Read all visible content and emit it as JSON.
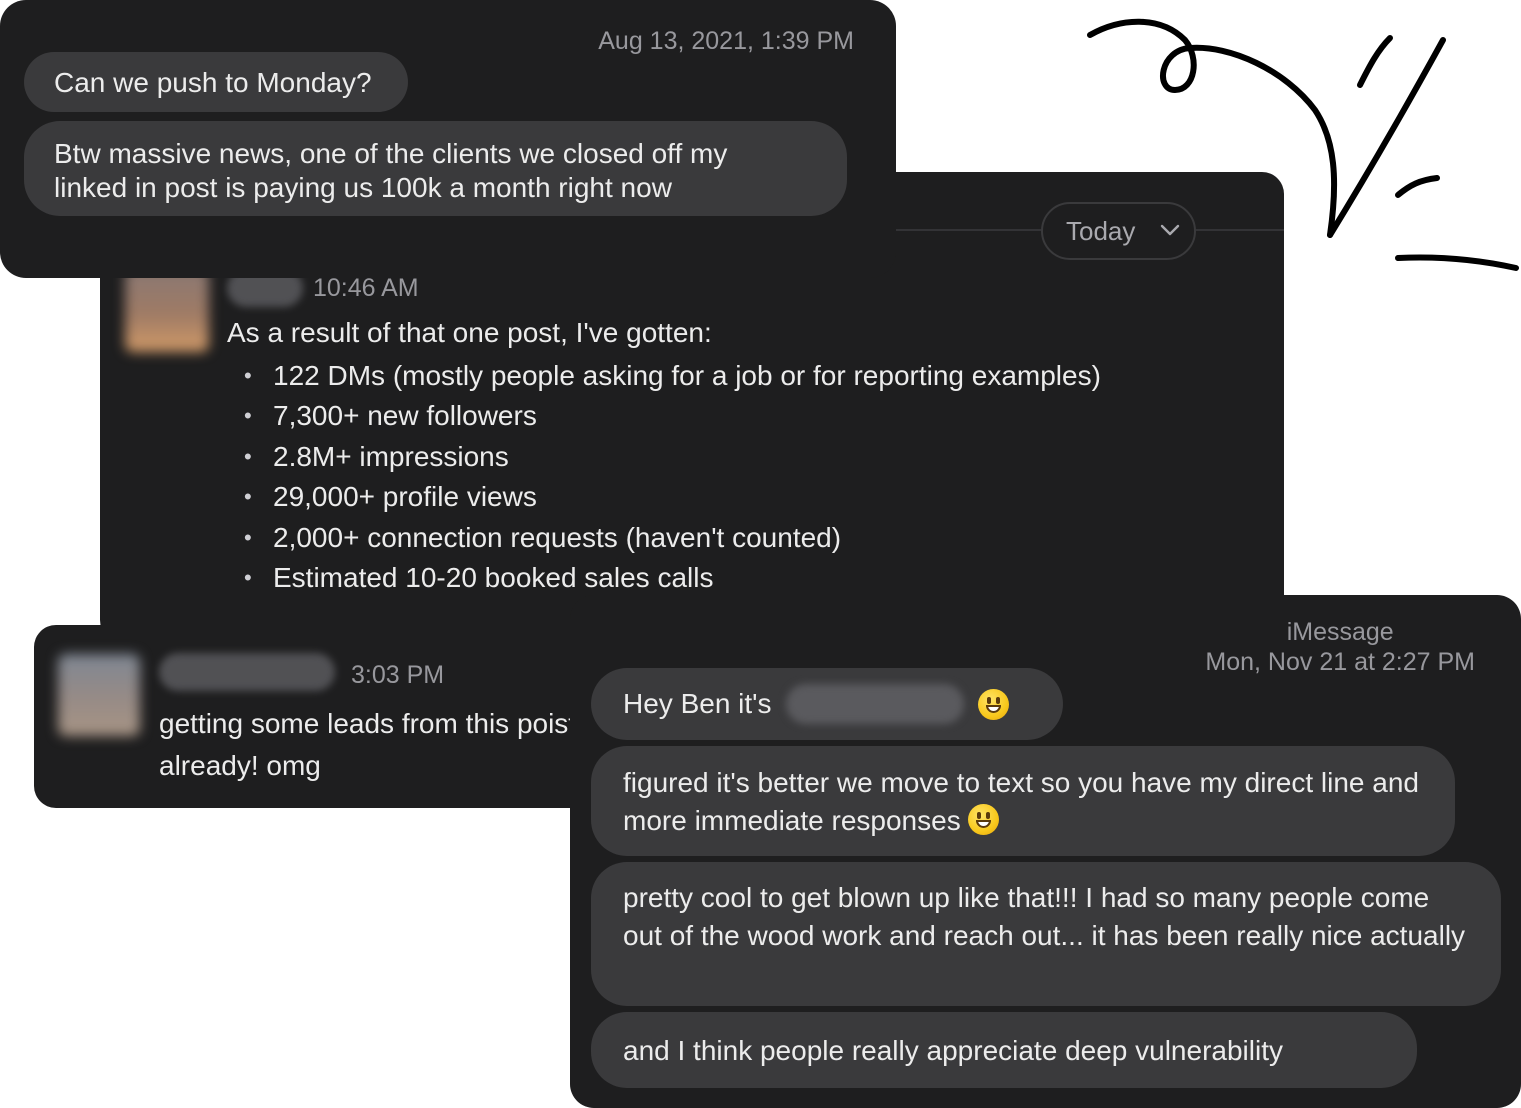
{
  "card1": {
    "timestamp": "Aug 13, 2021, 1:39 PM",
    "messages": [
      "Can we push to Monday?",
      "Btw massive news, one of the clients we closed off my\nlinked in post is paying us 100k a month right now"
    ]
  },
  "card2": {
    "date_pill": "Today",
    "time": "10:46 AM",
    "message": "As a result of that one post, I've gotten:",
    "bullets": [
      "122 DMs (mostly people asking for a job or for reporting examples)",
      "7,300+ new followers",
      "2.8M+ impressions",
      "29,000+ profile views",
      "2,000+ connection requests (haven't counted)",
      "Estimated 10-20 booked sales calls"
    ]
  },
  "card3": {
    "time": "3:03 PM",
    "message": "getting some leads from this poist already! omg"
  },
  "card4": {
    "service": "iMessage",
    "timestamp": "Mon, Nov 21 at 2:27 PM",
    "greeting": "Hey Ben it's",
    "messages": [
      "figured it's better we move to text so you have my direct line and more immediate responses",
      "pretty cool to get blown up like that!!! I had so many people come out of the wood work and reach out... it has been really nice actually",
      "and I think people really appreciate deep vulnerability"
    ]
  },
  "icons": {
    "emoji": "grinning-face-icon",
    "chevron": "chevron-down-icon"
  },
  "colors": {
    "card_bg": "#1e1e1f",
    "bubble_bg": "#3a3a3c",
    "text": "#ececec",
    "meta": "#98989d"
  }
}
